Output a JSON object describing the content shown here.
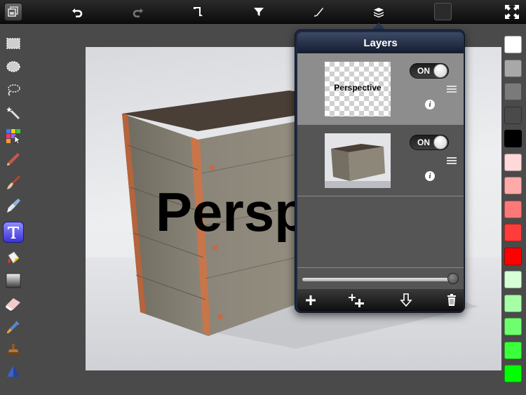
{
  "toolbar": {
    "items": [
      {
        "name": "gallery",
        "icon": "gallery-icon"
      },
      {
        "name": "undo",
        "icon": "undo-icon"
      },
      {
        "name": "redo",
        "icon": "redo-icon"
      },
      {
        "name": "transform",
        "icon": "transform-icon"
      },
      {
        "name": "filters",
        "icon": "funnel-icon"
      },
      {
        "name": "adjust",
        "icon": "brush-tip-icon"
      },
      {
        "name": "layers",
        "icon": "layers-icon"
      },
      {
        "name": "color",
        "icon": "color-well"
      },
      {
        "name": "fullscreen",
        "icon": "expand-icon"
      }
    ]
  },
  "tools": [
    "rect-select-icon",
    "ellipse-select-icon",
    "lasso-icon",
    "magic-wand-icon",
    "color-select-icon",
    "pencil-icon",
    "paintbrush-icon",
    "smudge-icon",
    "text-tool-icon",
    "fill-bucket-icon",
    "gradient-icon",
    "eraser-icon",
    "eyedropper-icon",
    "stamp-icon",
    "sharpen-icon"
  ],
  "active_tool": "text-tool-icon",
  "canvas": {
    "overlay_text": "Perspective"
  },
  "layers_panel": {
    "title": "Layers",
    "layers": [
      {
        "thumb_text": "Perspective",
        "toggle": "ON",
        "selected": true,
        "thumbnail": "transparent-text"
      },
      {
        "thumb_text": "",
        "toggle": "ON",
        "selected": false,
        "thumbnail": "box-photo"
      }
    ],
    "opacity": 1.0,
    "footer_buttons": [
      "add-layer-icon",
      "duplicate-layer-icon",
      "merge-down-icon",
      "trash-icon"
    ]
  },
  "swatches": {
    "colors": [
      "#ffffff",
      "#a8a8a8",
      "#7a7a7a",
      "#4a4a4a",
      "#000000",
      "#ffd9d9",
      "#ffa9a9",
      "#ff7878",
      "#ff3c3c",
      "#ff0000",
      "#d6ffd6",
      "#a6ffa6",
      "#6eff6e",
      "#3cff3c",
      "#00ff00"
    ]
  }
}
